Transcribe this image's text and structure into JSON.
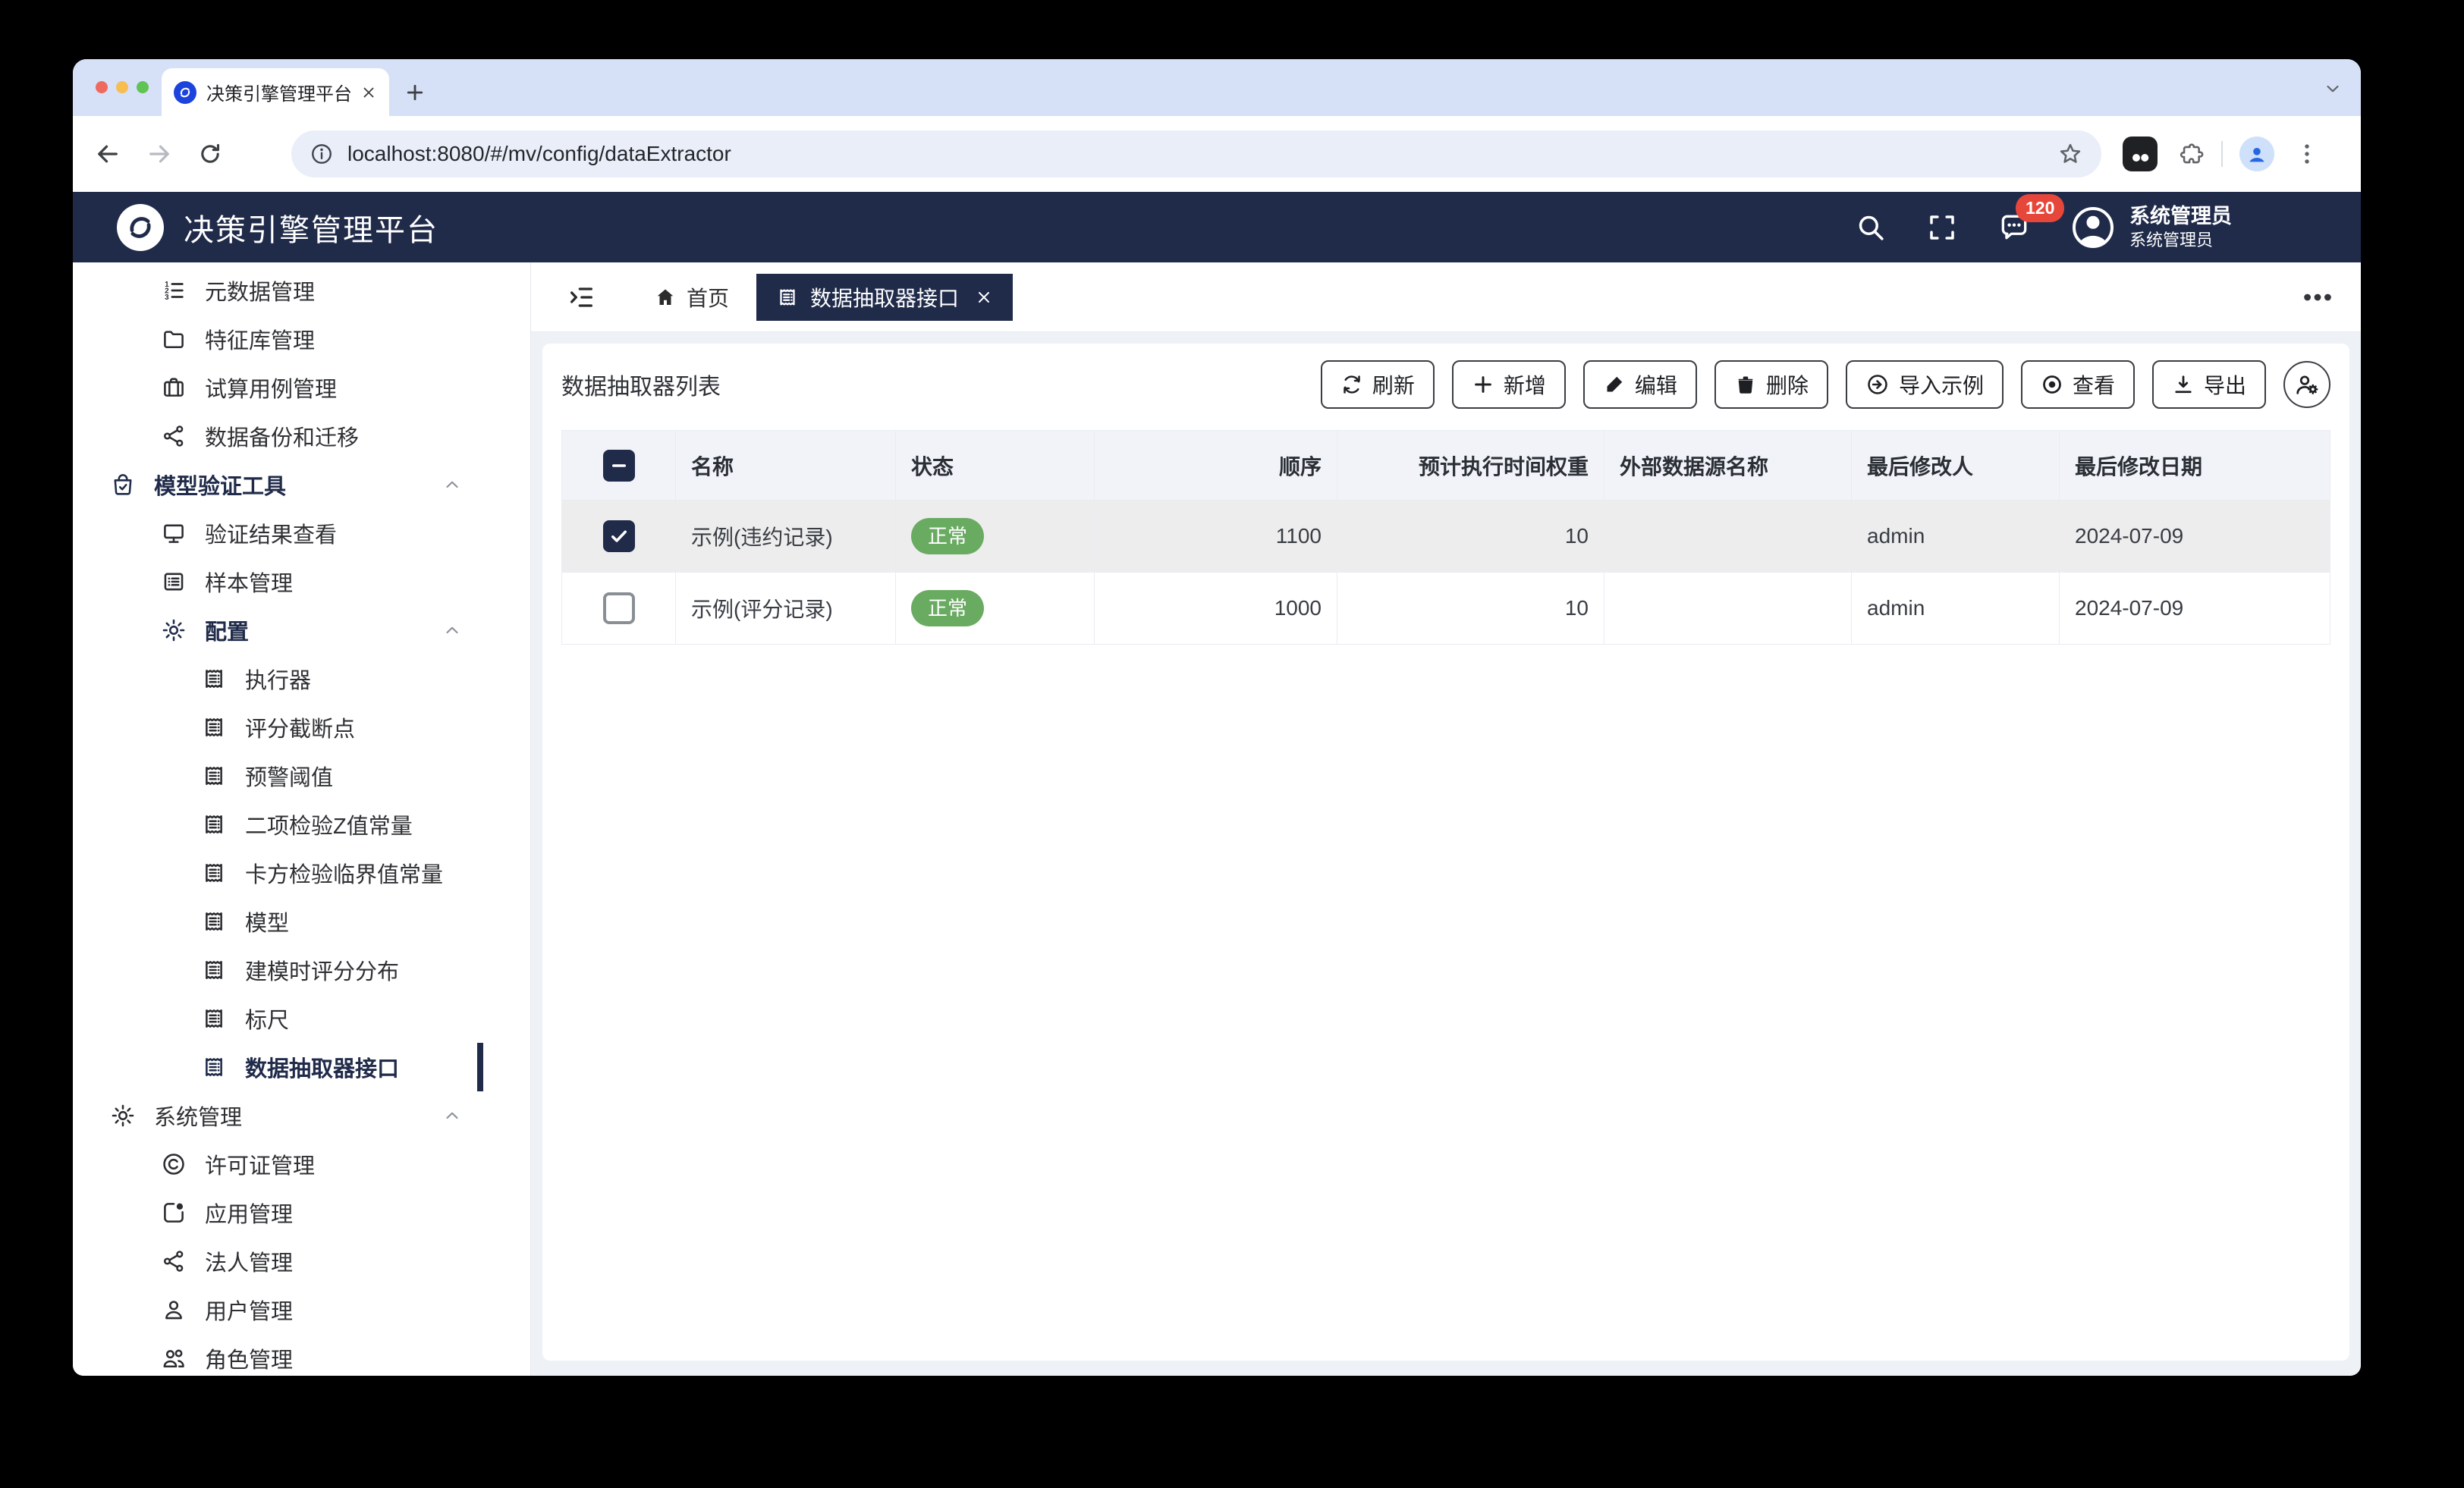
{
  "browser": {
    "tab_title": "决策引擎管理平台",
    "url": "localhost:8080/#/mv/config/dataExtractor"
  },
  "header": {
    "app_title": "决策引擎管理平台",
    "notification_count": "120",
    "user_name": "系统管理员",
    "user_role": "系统管理员"
  },
  "sidebar": {
    "items": [
      {
        "label": "元数据管理",
        "icon": "ordered-list-icon"
      },
      {
        "label": "特征库管理",
        "icon": "folder-icon"
      },
      {
        "label": "试算用例管理",
        "icon": "briefcase-icon"
      },
      {
        "label": "数据备份和迁移",
        "icon": "share-icon"
      },
      {
        "label": "模型验证工具",
        "icon": "bag-check-icon",
        "group": true,
        "expanded": true
      },
      {
        "label": "验证结果查看",
        "icon": "monitor-icon"
      },
      {
        "label": "样本管理",
        "icon": "list-box-icon"
      },
      {
        "label": "配置",
        "icon": "gear-icon",
        "group": true,
        "expanded": true
      },
      {
        "label": "执行器",
        "icon": "receipt-icon"
      },
      {
        "label": "评分截断点",
        "icon": "receipt-icon"
      },
      {
        "label": "预警阈值",
        "icon": "receipt-icon"
      },
      {
        "label": "二项检验Z值常量",
        "icon": "receipt-icon"
      },
      {
        "label": "卡方检验临界值常量",
        "icon": "receipt-icon"
      },
      {
        "label": "模型",
        "icon": "receipt-icon"
      },
      {
        "label": "建模时评分分布",
        "icon": "receipt-icon"
      },
      {
        "label": "标尺",
        "icon": "receipt-icon"
      },
      {
        "label": "数据抽取器接口",
        "icon": "receipt-icon",
        "active": true
      },
      {
        "label": "系统管理",
        "icon": "gear-icon",
        "group": true,
        "expanded": true
      },
      {
        "label": "许可证管理",
        "icon": "copyright-icon"
      },
      {
        "label": "应用管理",
        "icon": "app-box-icon"
      },
      {
        "label": "法人管理",
        "icon": "share-icon"
      },
      {
        "label": "用户管理",
        "icon": "user-icon"
      },
      {
        "label": "角色管理",
        "icon": "users-icon"
      }
    ]
  },
  "tabs": {
    "home": "首页",
    "active": "数据抽取器接口"
  },
  "toolbar": {
    "title": "数据抽取器列表",
    "buttons": [
      {
        "label": "刷新",
        "icon": "refresh-icon"
      },
      {
        "label": "新增",
        "icon": "plus-icon"
      },
      {
        "label": "编辑",
        "icon": "pencil-icon"
      },
      {
        "label": "删除",
        "icon": "trash-icon"
      },
      {
        "label": "导入示例",
        "icon": "import-icon"
      },
      {
        "label": "查看",
        "icon": "view-icon"
      },
      {
        "label": "导出",
        "icon": "export-icon"
      }
    ]
  },
  "table": {
    "columns": [
      "名称",
      "状态",
      "顺序",
      "预计执行时间权重",
      "外部数据源名称",
      "最后修改人",
      "最后修改日期"
    ],
    "rows": [
      {
        "name": "示例(违约记录)",
        "status": "正常",
        "order": "1100",
        "weight": "10",
        "datasource": "",
        "modified_by": "admin",
        "modified_date": "2024-07-09",
        "selected": true
      },
      {
        "name": "示例(评分记录)",
        "status": "正常",
        "order": "1000",
        "weight": "10",
        "datasource": "",
        "modified_by": "admin",
        "modified_date": "2024-07-09",
        "selected": false
      }
    ]
  },
  "colors": {
    "navy": "#202b4a",
    "status_green": "#6aab62",
    "badge_red": "#e7473a"
  }
}
